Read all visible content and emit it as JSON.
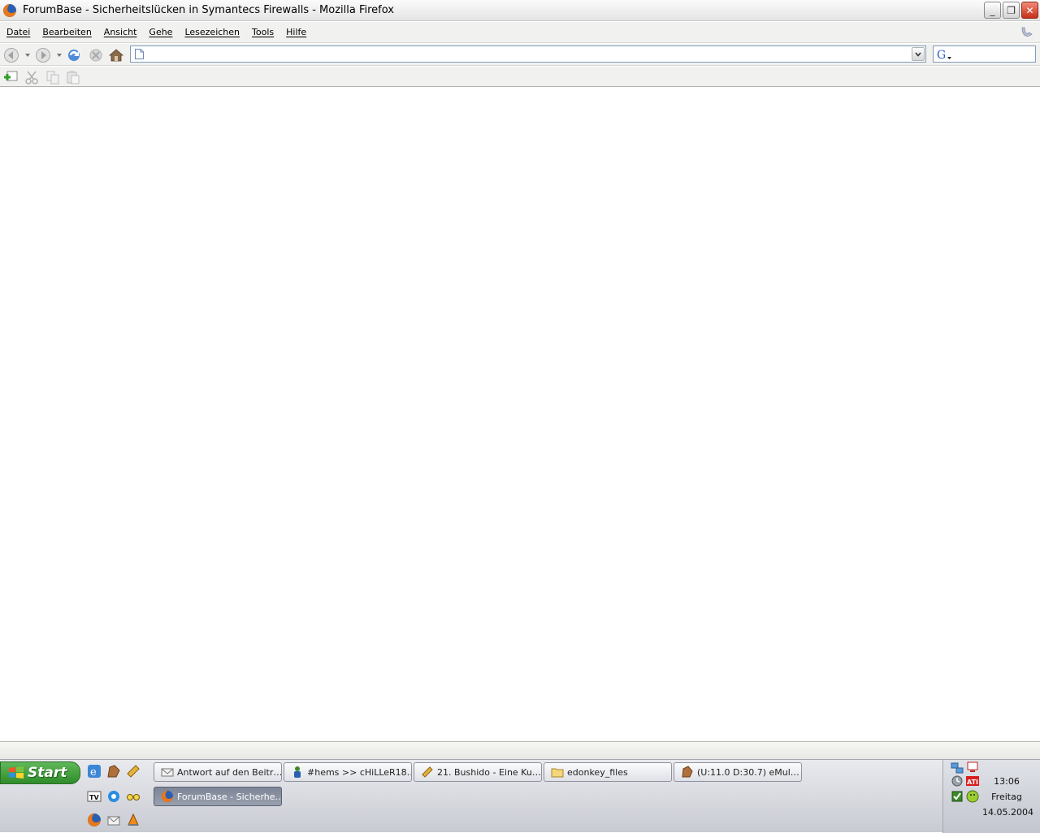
{
  "window": {
    "title": "ForumBase - Sicherheitslücken in Symantecs Firewalls - Mozilla Firefox",
    "buttons": {
      "minimize": "_",
      "maximize": "❐",
      "close": "✕"
    }
  },
  "menu": {
    "items": [
      {
        "label": "Datei"
      },
      {
        "label": "Bearbeiten"
      },
      {
        "label": "Ansicht"
      },
      {
        "label": "Gehe"
      },
      {
        "label": "Lesezeichen"
      },
      {
        "label": "Tools"
      },
      {
        "label": "Hilfe"
      }
    ]
  },
  "navigation": {
    "url_value": "",
    "search_value": ""
  },
  "taskbar": {
    "start_label": "Start",
    "tasks": [
      {
        "label": "Antwort auf den Beitr…",
        "icon": "mail-icon"
      },
      {
        "label": "#hems >> cHiLLeR18…",
        "icon": "chat-user-icon"
      },
      {
        "label": "21. Bushido - Eine Ku…",
        "icon": "music-icon"
      },
      {
        "label": "edonkey_files",
        "icon": "folder-icon"
      },
      {
        "label": "(U:11.0 D:30.7) eMul…",
        "icon": "emule-icon"
      },
      {
        "label": "ForumBase - Sicherhe…",
        "icon": "firefox-icon"
      }
    ],
    "clock": {
      "time": "13:06",
      "day": "Freitag",
      "date": "14.05.2004"
    }
  },
  "colors": {
    "start_green": "#3c9a36",
    "close_red": "#c7301a",
    "active_task": "#8790a2"
  }
}
